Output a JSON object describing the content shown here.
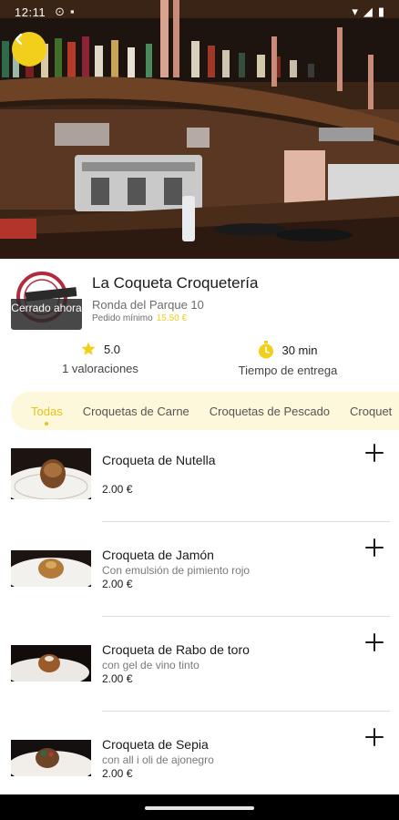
{
  "status_bar": {
    "time": "12:11"
  },
  "colors": {
    "accent": "#f2cf1a",
    "tab_bg": "#fdf8db",
    "closed_overlay": "#282828"
  },
  "hero": {
    "image": "restaurant-bar-photo"
  },
  "store": {
    "name": "La Coqueta Croquetería",
    "address": "Ronda del Parque 10",
    "min_order_label": "Pedido mínimo",
    "min_order_value": "15.50 €",
    "logo_status": "Cerrado ahora",
    "rating_value": "5.0",
    "rating_label": "1 valoraciones",
    "delivery_time": "30 min",
    "delivery_label": "Tiempo de entrega"
  },
  "categories": [
    {
      "label": "Todas",
      "active": true
    },
    {
      "label": "Croquetas de Carne",
      "active": false
    },
    {
      "label": "Croquetas de Pescado",
      "active": false
    },
    {
      "label": "Croquet",
      "active": false
    }
  ],
  "products": [
    {
      "name": "Croqueta de Nutella",
      "description": "",
      "price": "2.00 €"
    },
    {
      "name": "Croqueta de Jamón",
      "description": "Con emulsión de pimiento rojo",
      "price": "2.00 €"
    },
    {
      "name": "Croqueta de Rabo de toro",
      "description": "con gel de vino tinto",
      "price": "2.00 €"
    },
    {
      "name": "Croqueta de Sepia",
      "description": "con all i oli de ajonegro",
      "price": "2.00 €"
    }
  ]
}
